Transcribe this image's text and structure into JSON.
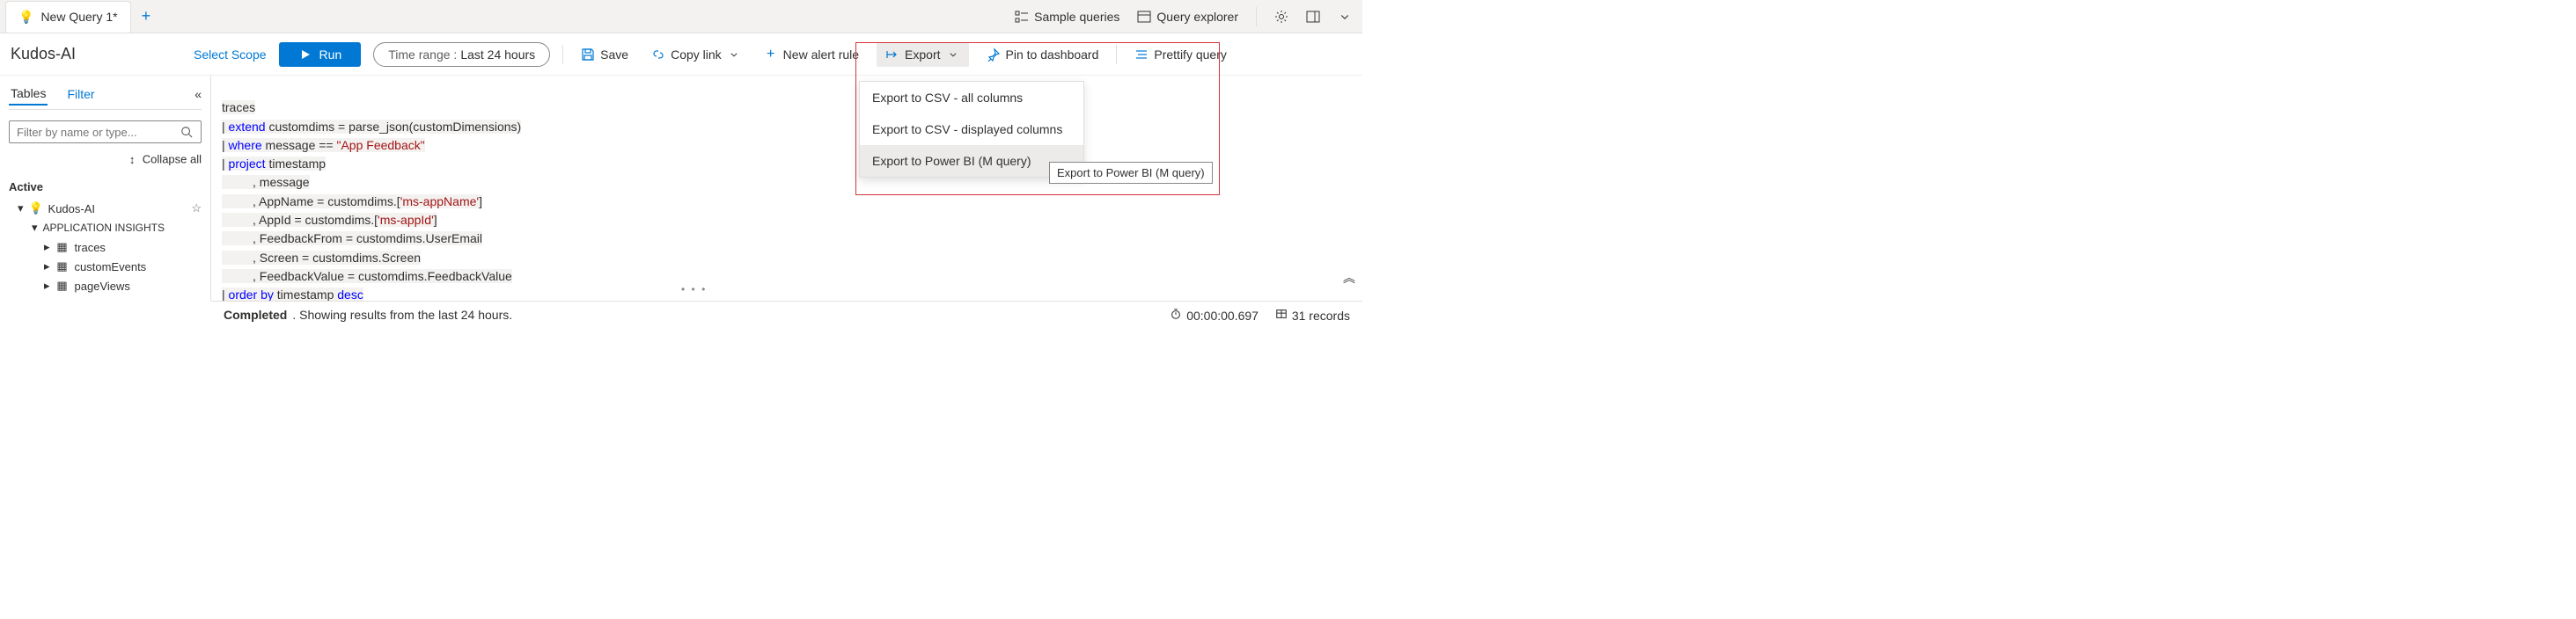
{
  "tab": {
    "label": "New Query 1*"
  },
  "top_right": {
    "sample": "Sample queries",
    "explorer": "Query explorer"
  },
  "toolbar": {
    "scope": "Kudos-AI",
    "select_scope": "Select Scope",
    "run": "Run",
    "time_label": "Time range :",
    "time_value": "Last 24 hours",
    "save": "Save",
    "copy": "Copy link",
    "alert": "New alert rule",
    "export": "Export",
    "pin": "Pin to dashboard",
    "prettify": "Prettify query"
  },
  "sidebar": {
    "tabs": {
      "tables": "Tables",
      "filter": "Filter"
    },
    "filter_placeholder": "Filter by name or type...",
    "collapse_all": "Collapse all",
    "active": "Active",
    "root": "Kudos-AI",
    "group": "APPLICATION INSIGHTS",
    "items": [
      "traces",
      "customEvents",
      "pageViews"
    ]
  },
  "export_menu": {
    "items": [
      "Export to CSV - all columns",
      "Export to CSV - displayed columns",
      "Export to Power BI (M query)"
    ],
    "tooltip": "Export to Power BI (M query)"
  },
  "query": {
    "l1": "traces",
    "l2a": "| ",
    "l2b": "extend",
    "l2c": " customdims = parse_json(customDimensions)",
    "l3a": "| ",
    "l3b": "where",
    "l3c": " message == ",
    "l3d": "\"App Feedback\"",
    "l4a": "| ",
    "l4b": "project",
    "l4c": " timestamp",
    "l5": "         , message",
    "l6a": "         , AppName = customdims.[",
    "l6b": "'ms-appName'",
    "l6c": "]",
    "l7a": "         , AppId = customdims.[",
    "l7b": "'ms-appId'",
    "l7c": "]",
    "l8": "         , FeedbackFrom = customdims.UserEmail",
    "l9": "         , Screen = customdims.Screen",
    "l10": "         , FeedbackValue = customdims.FeedbackValue",
    "l11a": "| ",
    "l11b": "order by",
    "l11c": " timestamp ",
    "l11d": "desc"
  },
  "status": {
    "completed": "Completed",
    "msg": ". Showing results from the last 24 hours.",
    "duration": "00:00:00.697",
    "records": "31 records"
  }
}
